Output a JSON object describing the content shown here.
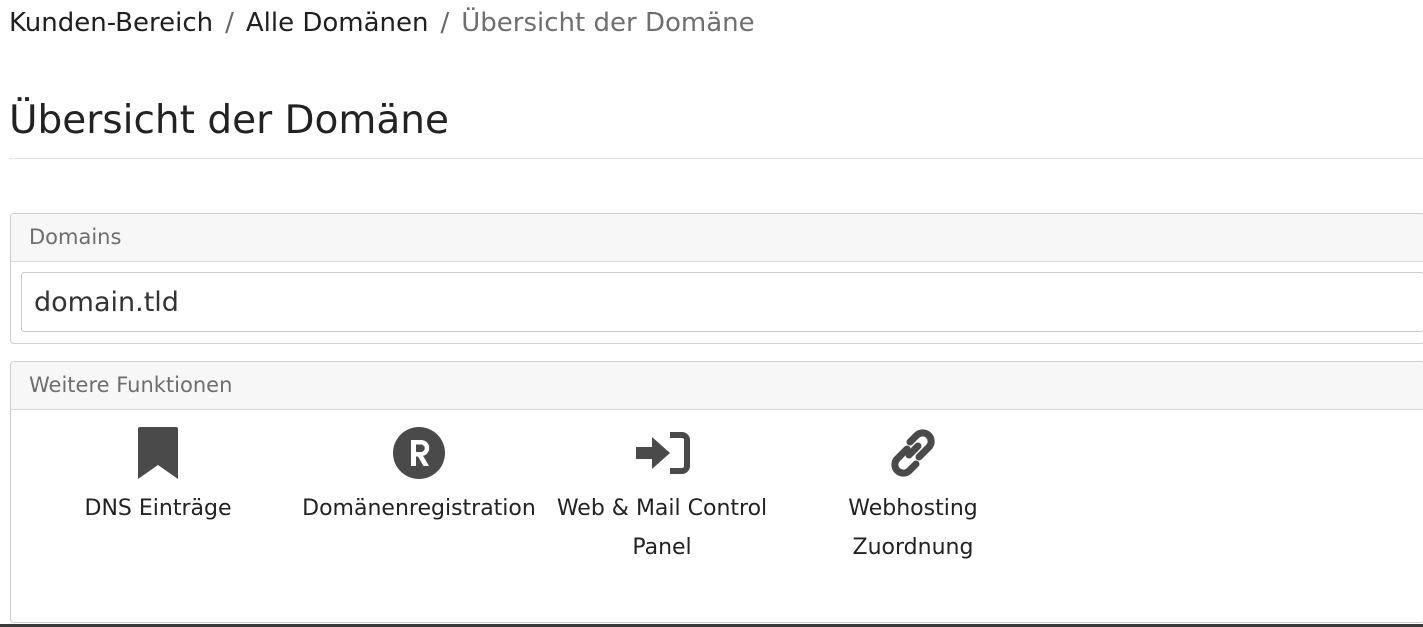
{
  "breadcrumb": {
    "items": [
      "Kunden-Bereich",
      "Alle Domänen"
    ],
    "separator": "/",
    "current": "Übersicht der Domäne"
  },
  "page_title": "Übersicht der Domäne",
  "domains_panel": {
    "heading": "Domains",
    "value": "domain.tld"
  },
  "functions_panel": {
    "heading": "Weitere Funktionen",
    "items": [
      {
        "icon": "bookmark-icon",
        "label": "DNS Einträge"
      },
      {
        "icon": "registered-icon",
        "label": "Domänenregistration"
      },
      {
        "icon": "sign-in-icon",
        "label_line1": "Web & Mail Control",
        "label_line2": "Panel"
      },
      {
        "icon": "link-icon",
        "label_line1": "Webhosting",
        "label_line2": "Zuordnung"
      }
    ]
  },
  "colors": {
    "icon": "#4a4a4a",
    "panel_header_bg": "#f7f7f7",
    "border": "#cfcfcf"
  }
}
